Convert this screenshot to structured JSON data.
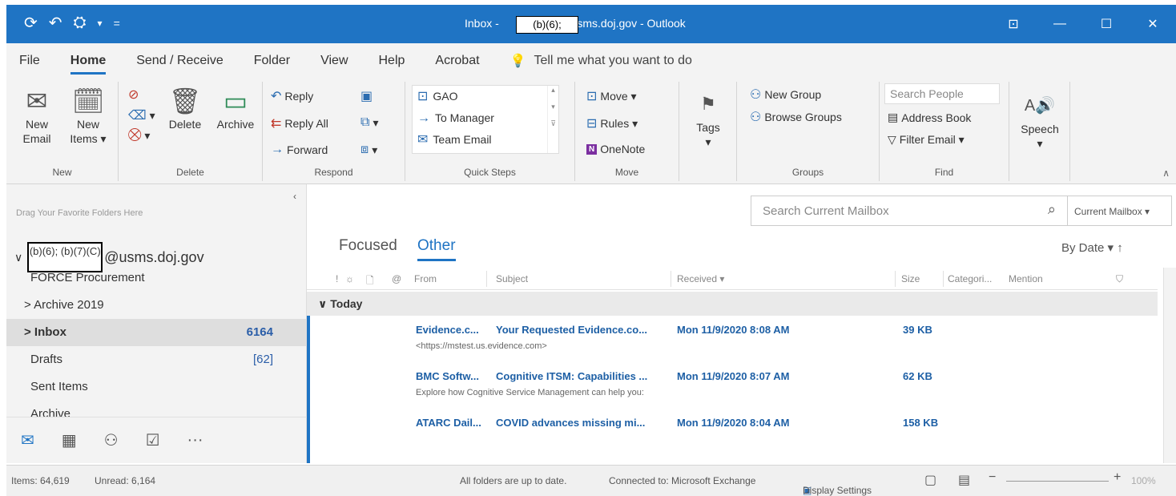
{
  "window": {
    "title_prefix": "Inbox -",
    "title_redaction": "(b)(6);",
    "title_suffix": "usms.doj.gov - Outlook",
    "quick_access": [
      "⟳",
      "↶",
      "⛭",
      "▾",
      "="
    ],
    "controls": [
      "⊡",
      "—",
      "☐",
      "✕"
    ]
  },
  "ribbon_tabs": [
    "File",
    "Home",
    "Send / Receive",
    "Folder",
    "View",
    "Help",
    "Acrobat"
  ],
  "tell_me": "Tell me what you want to do",
  "ribbon": {
    "new_group": {
      "label": "New",
      "new_email": [
        "New",
        "Email"
      ],
      "new_items": [
        "New",
        "Items ▾"
      ]
    },
    "delete_group": {
      "label": "Delete",
      "delete": "Delete",
      "archive": "Archive"
    },
    "respond_group": {
      "label": "Respond",
      "reply": "Reply",
      "reply_all": "Reply All",
      "forward": "Forward"
    },
    "quick_steps_group": {
      "label": "Quick Steps",
      "items": [
        "GAO",
        "To Manager",
        "Team Email"
      ]
    },
    "move_group": {
      "label": "Move",
      "move": "Move ▾",
      "rules": "Rules ▾",
      "onenote": "OneNote"
    },
    "tags_group": {
      "label": "Tags"
    },
    "groups_group": {
      "label": "Groups",
      "new_group": "New Group",
      "browse_groups": "Browse Groups"
    },
    "find_group": {
      "label": "Find",
      "search_people": "Search People",
      "address_book": "Address Book",
      "filter_email": "Filter Email ▾"
    },
    "speech_group": {
      "label": "Speech"
    }
  },
  "left_pane": {
    "drag_favorites": "Drag Your Favorite Folders Here",
    "account_redaction": "(b)(6); (b)(7)(C)",
    "account_suffix": "@usms.doj.gov",
    "folders": [
      {
        "name": "FORCE Procurement",
        "count": ""
      },
      {
        "name": "> Archive 2019",
        "count": ""
      },
      {
        "name": "> Inbox",
        "count": "6164"
      },
      {
        "name": "Drafts",
        "count": "[62]"
      },
      {
        "name": "Sent Items",
        "count": ""
      },
      {
        "name": "Archive",
        "count": ""
      }
    ],
    "more": "···"
  },
  "main": {
    "search_placeholder": "Search Current Mailbox",
    "search_scope": "Current Mailbox ▾",
    "tab_focused": "Focused",
    "tab_other": "Other",
    "sort": "By Date ▾  ↑",
    "columns": {
      "from": "From",
      "subject": "Subject",
      "received": "Received ▾",
      "size": "Size",
      "categories": "Categori...",
      "mention": "Mention"
    },
    "group_today": "∨  Today",
    "messages": [
      {
        "from": "Evidence.c...",
        "subject": "Your Requested Evidence.co...",
        "received": "Mon 11/9/2020 8:08 AM",
        "size": "39 KB",
        "preview": "<https://mstest.us.evidence.com>"
      },
      {
        "from": "BMC Softw...",
        "subject": "Cognitive ITSM: Capabilities ...",
        "received": "Mon 11/9/2020 8:07 AM",
        "size": "62 KB",
        "preview": "Explore how Cognitive Service Management can help you:"
      },
      {
        "from": "ATARC Dail...",
        "subject": "COVID advances missing mi...",
        "received": "Mon 11/9/2020 8:04 AM",
        "size": "158 KB",
        "preview": ""
      }
    ]
  },
  "status_bar": {
    "items": "Items: 64,619",
    "unread": "Unread: 6,164",
    "sync": "All folders are up to date.",
    "connection": "Connected to: Microsoft Exchange",
    "display_settings": "Display Settings",
    "zoom": "100%"
  }
}
